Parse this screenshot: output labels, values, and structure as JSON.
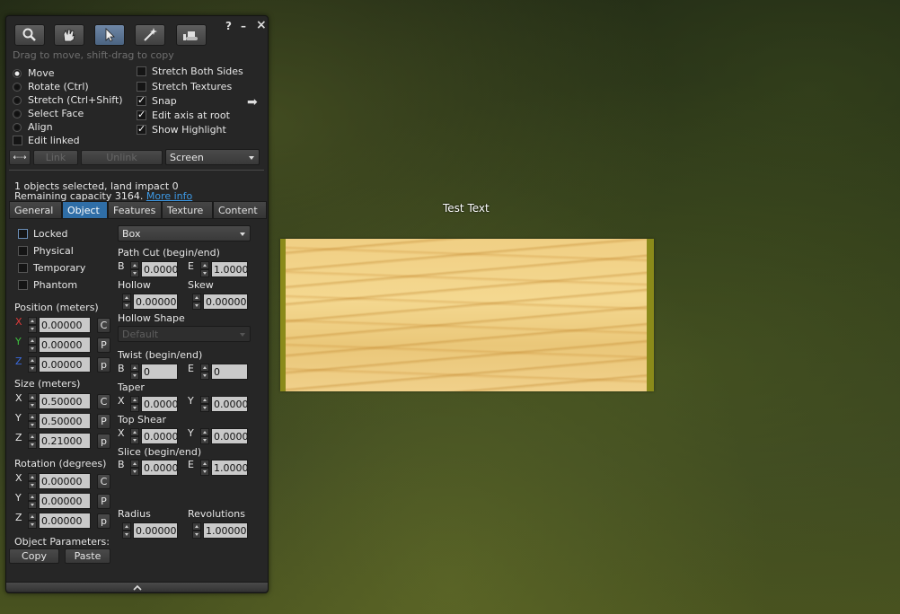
{
  "world": {
    "hover_text": "Test Text"
  },
  "window": {
    "help": "?",
    "minimize": "–",
    "close": "×"
  },
  "toolbar": {
    "hint": "Drag to move, shift-drag to copy"
  },
  "modes": [
    {
      "label": "Move",
      "selected": true
    },
    {
      "label": "Rotate (Ctrl)",
      "selected": false
    },
    {
      "label": "Stretch (Ctrl+Shift)",
      "selected": false
    },
    {
      "label": "Select Face",
      "selected": false
    },
    {
      "label": "Align",
      "selected": false
    }
  ],
  "edit_linked": {
    "label": "Edit linked",
    "checked": false
  },
  "options": [
    {
      "label": "Stretch Both Sides",
      "checked": false
    },
    {
      "label": "Stretch Textures",
      "checked": false
    },
    {
      "label": "Snap",
      "checked": true
    },
    {
      "label": "Edit axis at root",
      "checked": true
    },
    {
      "label": "Show Highlight",
      "checked": true
    }
  ],
  "link_row": {
    "link": "Link",
    "unlink": "Unlink",
    "ruler": "Screen"
  },
  "selection": {
    "line1": "1 objects selected, land impact 0",
    "line2": "Remaining capacity 3164.",
    "more_info": "More info"
  },
  "tabs": [
    "General",
    "Object",
    "Features",
    "Texture",
    "Content"
  ],
  "flags": [
    {
      "label": "Locked",
      "checked": false
    },
    {
      "label": "Physical",
      "checked": false
    },
    {
      "label": "Temporary",
      "checked": false
    },
    {
      "label": "Phantom",
      "checked": false
    }
  ],
  "position": {
    "title": "Position (meters)",
    "x": "0.00000",
    "y": "0.00000",
    "z": "0.00000",
    "btn1": "C",
    "btn2": "P",
    "btn3": "p"
  },
  "size": {
    "title": "Size (meters)",
    "x": "0.50000",
    "y": "0.50000",
    "z": "0.21000",
    "btn1": "C",
    "btn2": "P",
    "btn3": "p"
  },
  "rotation": {
    "title": "Rotation (degrees)",
    "x": "0.00000",
    "y": "0.00000",
    "z": "0.00000",
    "btn1": "C",
    "btn2": "P",
    "btn3": "p"
  },
  "axes": {
    "x": "X",
    "y": "Y",
    "z": "Z"
  },
  "obj_params": {
    "title": "Object Parameters:",
    "copy": "Copy",
    "paste": "Paste"
  },
  "shape": {
    "type": "Box",
    "path_cut_title": "Path Cut (begin/end)",
    "b_label": "B",
    "e_label": "E",
    "path_cut_b": "0.0000",
    "path_cut_e": "1.0000",
    "hollow_title": "Hollow",
    "hollow": "0.00000",
    "skew_title": "Skew",
    "skew": "0.00000",
    "hollow_shape_title": "Hollow Shape",
    "hollow_shape": "Default",
    "twist_title": "Twist (begin/end)",
    "twist_b": "0",
    "twist_e": "0",
    "taper_title": "Taper",
    "x_label": "X",
    "y_label": "Y",
    "taper_x": "0.0000",
    "taper_y": "0.0000",
    "top_shear_title": "Top Shear",
    "shear_x": "0.0000",
    "shear_y": "0.0000",
    "slice_title": "Slice (begin/end)",
    "slice_b": "0.0000",
    "slice_e": "1.0000",
    "radius_title": "Radius",
    "radius": "0.00000",
    "revolutions_title": "Revolutions",
    "revolutions": "1.00000"
  }
}
